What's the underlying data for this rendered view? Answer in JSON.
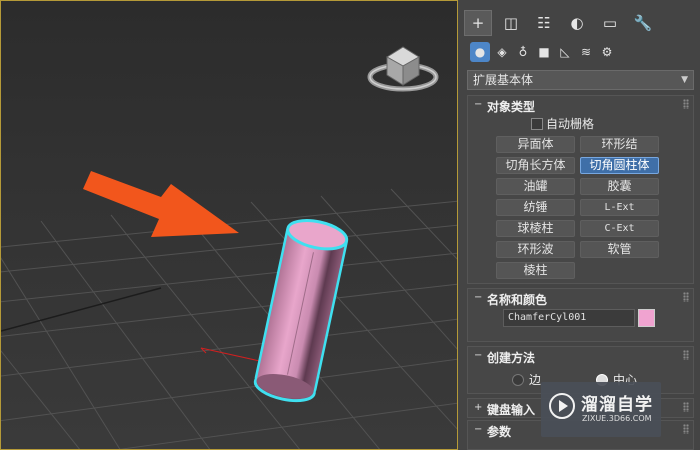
{
  "command_panel": {
    "tabs": [
      {
        "icon": "plus-icon",
        "glyph": "+"
      },
      {
        "icon": "modify-icon",
        "glyph": "◫"
      },
      {
        "icon": "hierarchy-icon",
        "glyph": "☷"
      },
      {
        "icon": "motion-icon",
        "glyph": "◐"
      },
      {
        "icon": "display-icon",
        "glyph": "▭"
      },
      {
        "icon": "utilities-icon",
        "glyph": "🔧"
      }
    ],
    "subtabs": [
      {
        "icon": "geometry-icon",
        "glyph": "●"
      },
      {
        "icon": "shapes-icon",
        "glyph": "◈"
      },
      {
        "icon": "lights-icon",
        "glyph": "♁"
      },
      {
        "icon": "cameras-icon",
        "glyph": "■"
      },
      {
        "icon": "helpers-icon",
        "glyph": "◺"
      },
      {
        "icon": "spacewarps-icon",
        "glyph": "≋"
      },
      {
        "icon": "systems-icon",
        "glyph": "⚙"
      }
    ],
    "category": "扩展基本体",
    "object_type": {
      "title": "对象类型",
      "autogrid_label": "自动栅格",
      "buttons": [
        "异面体",
        "环形结",
        "切角长方体",
        "切角圆柱体",
        "油罐",
        "胶囊",
        "纺锤",
        "L-Ext",
        "球棱柱",
        "C-Ext",
        "环形波",
        "软管",
        "棱柱"
      ],
      "active_button": "切角圆柱体"
    },
    "name_color": {
      "title": "名称和颜色",
      "name_value": "ChamferCyl001",
      "color": "#f0a3d0"
    },
    "creation_method": {
      "title": "创建方法",
      "option_edge": "边",
      "option_center": "中心",
      "selected": "中心"
    },
    "keyboard_entry": {
      "title": "键盘输入"
    },
    "parameters": {
      "title": "参数"
    }
  },
  "viewport": {
    "object_color": "#e6a0c6",
    "selection_outline_color": "#3fe0f0",
    "arrow_color": "#f2561c"
  },
  "watermark": {
    "title": "溜溜自学",
    "url": "ZIXUE.3D66.COM"
  }
}
